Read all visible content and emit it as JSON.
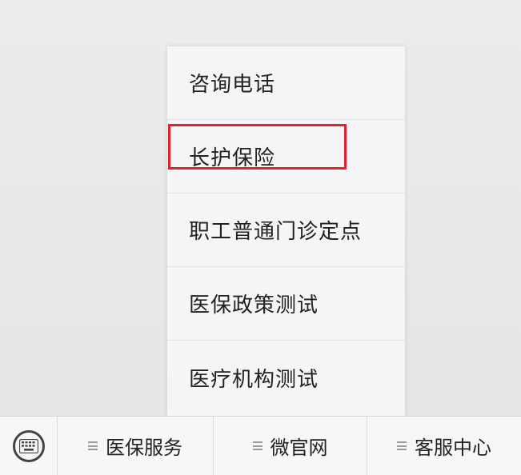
{
  "submenu": {
    "items": [
      {
        "label": "咨询电话"
      },
      {
        "label": "长护保险"
      },
      {
        "label": "职工普通门诊定点"
      },
      {
        "label": "医保政策测试"
      },
      {
        "label": "医疗机构测试"
      }
    ]
  },
  "bottom_bar": {
    "keyboard_icon": "keyboard-icon",
    "tabs": [
      {
        "label": "医保服务",
        "icon": "menu-lines-icon"
      },
      {
        "label": "微官网",
        "icon": "menu-lines-icon"
      },
      {
        "label": "客服中心",
        "icon": "menu-lines-icon"
      }
    ]
  },
  "colors": {
    "highlight_border": "#e0232f",
    "background": "#e8e8e8",
    "menu_background": "#f5f5f5"
  }
}
